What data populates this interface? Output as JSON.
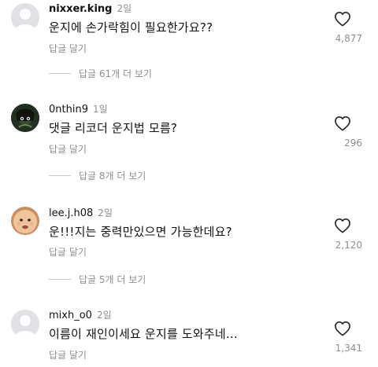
{
  "comments": [
    {
      "username": "nixxer.king",
      "time": "2일",
      "text": "운지에 손가락힘이 필요한가요??",
      "reply_label": "답글 달기",
      "like_count": "4,877",
      "view_replies": "답글 61개 더 보기",
      "avatar": "default-avatar-icon"
    },
    {
      "username": "0nthin9",
      "time": "1일",
      "text": "댓글 리코더 운지법 모름?",
      "reply_label": "답글 달기",
      "like_count": "296",
      "view_replies": "답글 8개 더 보기",
      "avatar": "profile-photo"
    },
    {
      "username": "lee.j.h08",
      "time": "2일",
      "text": "운!!!지는 중력만있으면 가능한데요?",
      "reply_label": "답글 달기",
      "like_count": "2,120",
      "view_replies": "답글 5개 더 보기",
      "avatar": "profile-photo"
    },
    {
      "username": "mixh_o0",
      "time": "2일",
      "text": "이름이 재인이세요 운지를 도와주네...",
      "reply_label": "답글 달기",
      "like_count": "1,341",
      "avatar": "default-avatar-icon"
    }
  ],
  "icons": {
    "like": "heart-outline-icon",
    "default_avatar": "default-avatar-icon"
  },
  "colors": {
    "text": "#111111",
    "secondary": "#8e8e8e",
    "divider": "#c7c7c7"
  }
}
